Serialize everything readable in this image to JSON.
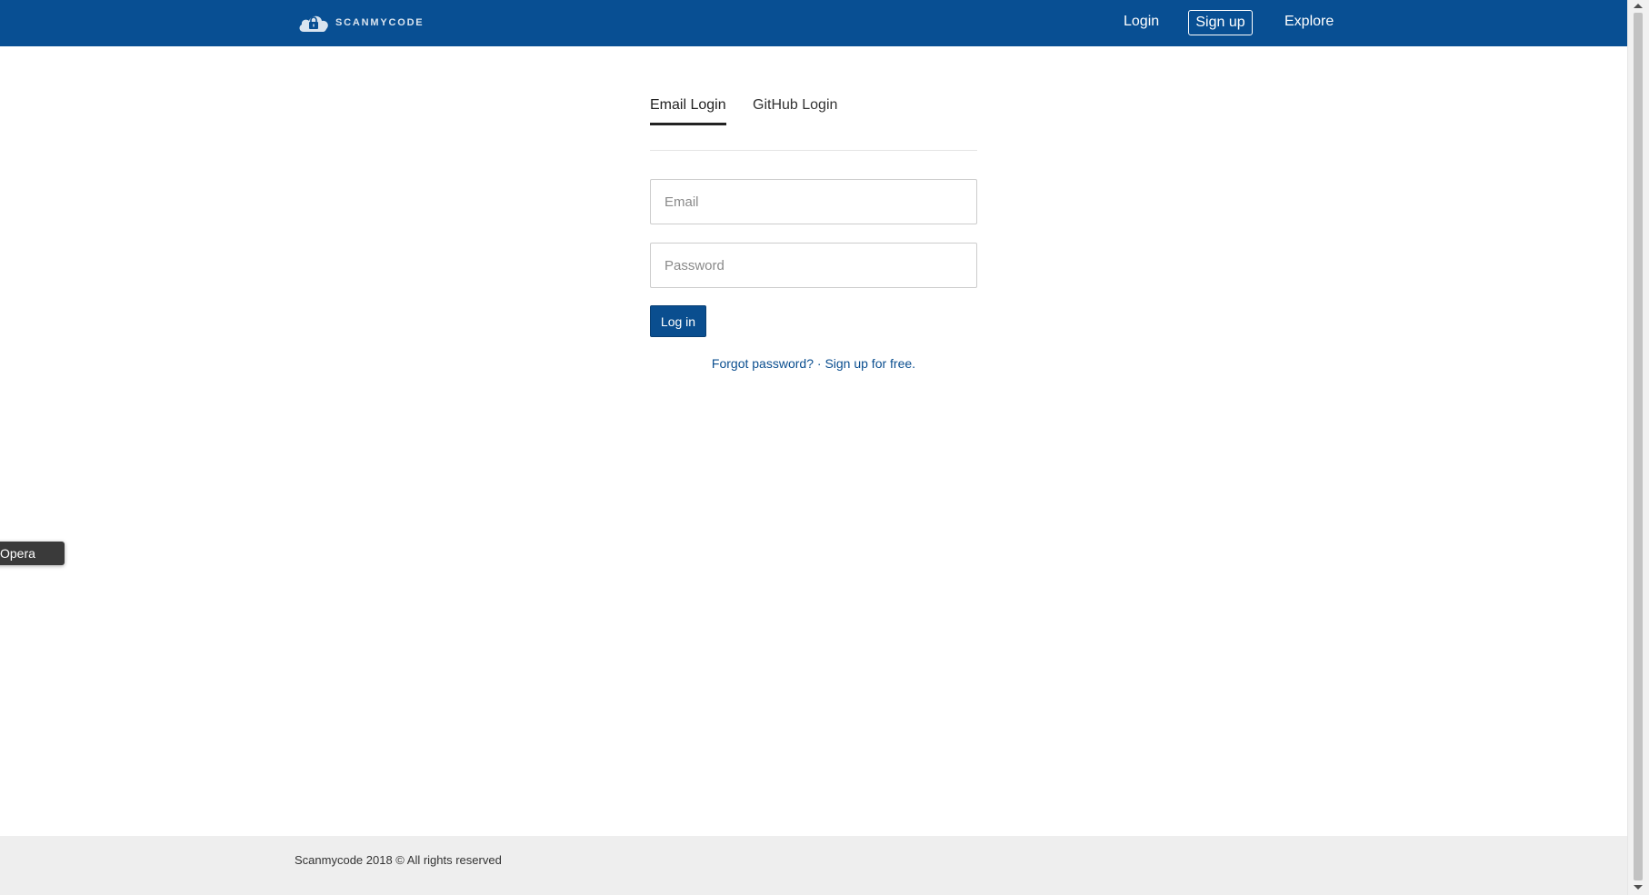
{
  "header": {
    "logo_text": "SCANMYCODE",
    "nav": {
      "login": "Login",
      "signup": "Sign up",
      "explore": "Explore"
    }
  },
  "auth": {
    "tabs": {
      "email": "Email Login",
      "github": "GitHub Login"
    },
    "email_placeholder": "Email",
    "password_placeholder": "Password",
    "login_button": "Log in",
    "forgot_password": "Forgot password?",
    "separator": " · ",
    "signup_free": "Sign up for free."
  },
  "tooltip": {
    "text": "Opera"
  },
  "footer": {
    "text": "Scanmycode 2018 © All rights reserved"
  },
  "colors": {
    "brand": "#084f93",
    "link": "#0a4e8f",
    "footer_bg": "#eeeeee"
  }
}
